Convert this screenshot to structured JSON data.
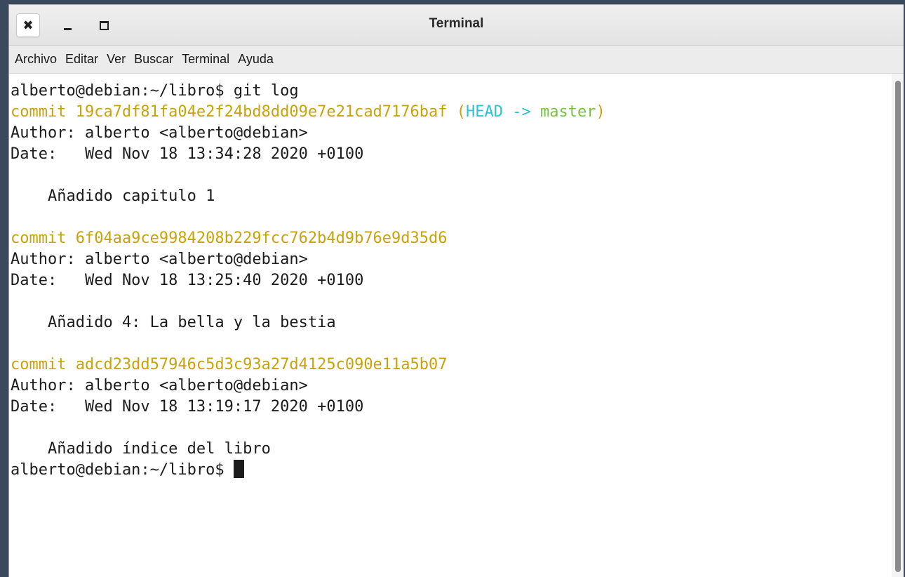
{
  "window": {
    "title": "Terminal",
    "close_glyph": "✖",
    "minimize_glyph": "‗",
    "icons": [
      "close-icon",
      "minimize-icon",
      "maximize-icon"
    ]
  },
  "menu": {
    "items": [
      "Archivo",
      "Editar",
      "Ver",
      "Buscar",
      "Terminal",
      "Ayuda"
    ]
  },
  "colors": {
    "commit": "#c9a20a",
    "head": "#2ac3d6",
    "branch": "#76c43c",
    "text": "#1c1c1c"
  },
  "terminal": {
    "prompt": "alberto@debian:~/libro$",
    "command": "git log",
    "commits": [
      {
        "commit_line": "commit 19ca7df81fa04e2f24bd8dd09e7e21cad7176baf",
        "ref_open": "(",
        "head": "HEAD ->",
        "branch": "master",
        "ref_close": ")",
        "author": "Author: alberto <alberto@debian>",
        "date": "Date:   Wed Nov 18 13:34:28 2020 +0100",
        "message": "    Añadido capitulo 1"
      },
      {
        "commit_line": "commit 6f04aa9ce9984208b229fcc762b4d9b76e9d35d6",
        "author": "Author: alberto <alberto@debian>",
        "date": "Date:   Wed Nov 18 13:25:40 2020 +0100",
        "message": "    Añadido 4: La bella y la bestia"
      },
      {
        "commit_line": "commit adcd23dd57946c5d3c93a27d4125c090e11a5b07",
        "author": "Author: alberto <alberto@debian>",
        "date": "Date:   Wed Nov 18 13:19:17 2020 +0100",
        "message": "    Añadido índice del libro"
      }
    ],
    "final_prompt": "alberto@debian:~/libro$ "
  }
}
